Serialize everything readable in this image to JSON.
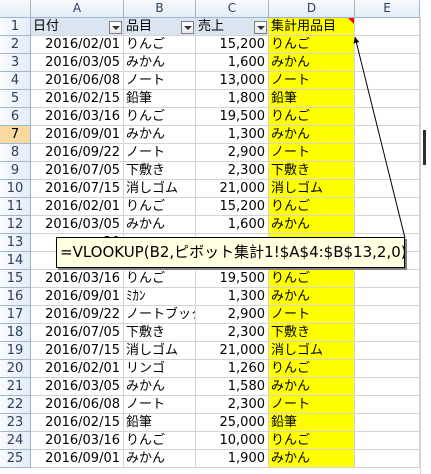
{
  "columns": [
    "A",
    "B",
    "C",
    "D",
    "E"
  ],
  "headers": [
    "日付",
    "品目",
    "売上",
    "集計用品目"
  ],
  "rows": [
    {
      "num": "2",
      "date": "2016/02/01",
      "item": "りんご",
      "sales": "15,200",
      "agg": "りんご"
    },
    {
      "num": "3",
      "date": "2016/03/05",
      "item": "みかん",
      "sales": "1,600",
      "agg": "みかん"
    },
    {
      "num": "4",
      "date": "2016/06/08",
      "item": "ノート",
      "sales": "13,000",
      "agg": "ノート"
    },
    {
      "num": "5",
      "date": "2016/02/15",
      "item": "鉛筆",
      "sales": "1,800",
      "agg": "鉛筆"
    },
    {
      "num": "6",
      "date": "2016/03/16",
      "item": "りんご",
      "sales": "19,500",
      "agg": "りんご"
    },
    {
      "num": "7",
      "date": "2016/09/01",
      "item": "みかん",
      "sales": "1,300",
      "agg": "みかん"
    },
    {
      "num": "8",
      "date": "2016/09/22",
      "item": "ノート",
      "sales": "2,900",
      "agg": "ノート"
    },
    {
      "num": "9",
      "date": "2016/07/05",
      "item": "下敷き",
      "sales": "2,300",
      "agg": "下敷き"
    },
    {
      "num": "10",
      "date": "2016/07/15",
      "item": "消しゴム",
      "sales": "21,000",
      "agg": "消しゴム"
    },
    {
      "num": "11",
      "date": "2016/02/01",
      "item": "りんご",
      "sales": "15,200",
      "agg": "りんご"
    },
    {
      "num": "12",
      "date": "2016/03/05",
      "item": "みかん",
      "sales": "1,600",
      "agg": "みかん"
    },
    {
      "num": "13",
      "date": "20",
      "item": "",
      "sales": "",
      "agg": ""
    },
    {
      "num": "14",
      "date": "20",
      "item": "",
      "sales": "",
      "agg": ""
    },
    {
      "num": "15",
      "date": "2016/03/16",
      "item": "りんご",
      "sales": "19,500",
      "agg": "りんご"
    },
    {
      "num": "16",
      "date": "2016/09/01",
      "item": "ﾐｶﾝ",
      "sales": "1,300",
      "agg": "みかん"
    },
    {
      "num": "17",
      "date": "2016/09/22",
      "item": "ノートブック",
      "sales": "2,900",
      "agg": "ノート"
    },
    {
      "num": "18",
      "date": "2016/07/05",
      "item": "下敷き",
      "sales": "2,300",
      "agg": "下敷き"
    },
    {
      "num": "19",
      "date": "2016/07/15",
      "item": "消しゴム",
      "sales": "21,000",
      "agg": "消しゴム"
    },
    {
      "num": "20",
      "date": "2016/02/01",
      "item": "リンゴ",
      "sales": "1,260",
      "agg": "りんご"
    },
    {
      "num": "21",
      "date": "2016/03/05",
      "item": "みかん",
      "sales": "1,580",
      "agg": "みかん"
    },
    {
      "num": "22",
      "date": "2016/06/08",
      "item": "ノート",
      "sales": "2,300",
      "agg": "ノート"
    },
    {
      "num": "23",
      "date": "2016/02/15",
      "item": "鉛筆",
      "sales": "25,000",
      "agg": "鉛筆"
    },
    {
      "num": "24",
      "date": "2016/03/16",
      "item": "りんご",
      "sales": "10,000",
      "agg": "りんご"
    },
    {
      "num": "25",
      "date": "2016/09/01",
      "item": "みかん",
      "sales": "1,900",
      "agg": "みかん"
    }
  ],
  "formula": "=VLOOKUP(B2,ピボット集計1!$A$4:$B$13,2,0)",
  "selected_row": "7",
  "colors": {
    "highlight": "#ffff00",
    "header_fill": "#dbe5f1",
    "comment_box": "#ffffe1"
  }
}
